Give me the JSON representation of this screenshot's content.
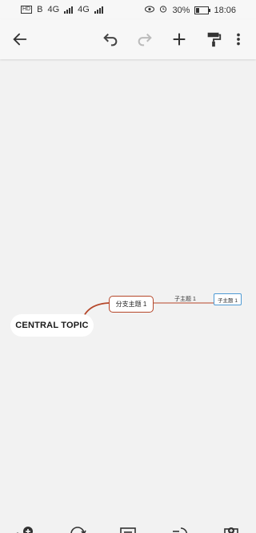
{
  "status_bar": {
    "network_badge": "HD",
    "net1": "B",
    "net2": "4G",
    "net3": "4G",
    "battery_percent": "30%",
    "battery_level": 0.3,
    "time": "18:06"
  },
  "toolbar": {
    "icons": [
      "back-arrow-icon",
      "undo-icon",
      "redo-icon",
      "add-icon",
      "format-painter-icon",
      "more-icon"
    ]
  },
  "mindmap": {
    "central_topic": "CENTRAL TOPIC",
    "branch_topic": "分支主题 1",
    "subtopic_label": "子主题 1",
    "subtopic_selected": "子主题 1",
    "connector_color": "#b5472a",
    "selection_color": "#4f9bd4"
  },
  "bottom_bar": {
    "icons": [
      "add-subtopic-icon",
      "relationship-icon",
      "note-icon",
      "boundary-icon",
      "topic-settings-icon"
    ]
  }
}
